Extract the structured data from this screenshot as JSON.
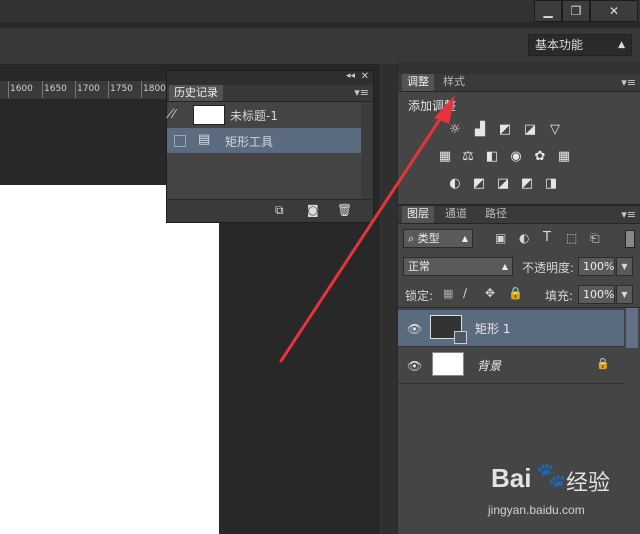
{
  "window": {
    "minimize_label": "▁",
    "restore_label": "❐",
    "close_label": "✕"
  },
  "options_bar": {
    "workspace": "基本功能"
  },
  "ruler": {
    "ticks": [
      "1600",
      "1650",
      "1700",
      "1750",
      "1800"
    ]
  },
  "history_panel": {
    "tab_title": "历史记录",
    "snapshot_label": "未标题-1",
    "steps": [
      {
        "label": "矩形工具"
      }
    ]
  },
  "adjustments_panel": {
    "tabs": [
      "调整",
      "样式"
    ],
    "heading": "添加调整"
  },
  "layers_panel": {
    "tabs": [
      "图层",
      "通道",
      "路径"
    ],
    "filter_kind": "类型",
    "blend_mode": "正常",
    "opacity_label": "不透明度:",
    "opacity_value": "100%",
    "lock_label": "锁定:",
    "fill_label": "填充:",
    "fill_value": "100%",
    "layers": [
      {
        "name": "矩形 1",
        "selected": true
      },
      {
        "name": "背景",
        "selected": false
      }
    ]
  },
  "watermark": {
    "brand": "Bai",
    "brand_suffix": "经验",
    "url": "jingyan.baidu.com"
  },
  "colors": {
    "annotation_arrow": "#e8333a",
    "selection": "#5a6b80"
  }
}
